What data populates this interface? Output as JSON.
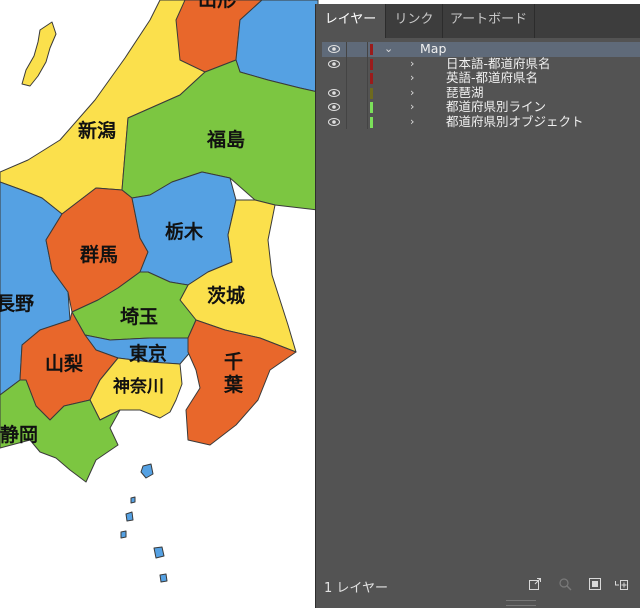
{
  "map": {
    "colors": {
      "yellow": "#fbe04c",
      "green": "#7cc641",
      "blue": "#55a1e3",
      "orange": "#e8672b",
      "sea": "#ffffff",
      "border": "#3a3a3a"
    },
    "prefectures": {
      "niigata": "新潟",
      "fukushima": "福島",
      "tochigi": "栃木",
      "gunma": "群馬",
      "ibaraki": "茨城",
      "nagano": "長野",
      "saitama": "埼玉",
      "yamanashi": "山梨",
      "tokyo": "東京",
      "chiba_1": "千",
      "chiba_2": "葉",
      "kanagawa": "神奈川",
      "shizuoka": "静岡",
      "yamagata_partial": "山形"
    }
  },
  "layers_panel": {
    "tabs": [
      {
        "label": "レイヤー",
        "active": true
      },
      {
        "label": "リンク",
        "active": false
      },
      {
        "label": "アートボード",
        "active": false
      }
    ],
    "layers": [
      {
        "name": "Map",
        "expanded": true,
        "visible": true,
        "color": "#9b1b1b"
      },
      {
        "name": "日本語-都道府県名",
        "expanded": false,
        "visible": true,
        "color": "#9b1b1b"
      },
      {
        "name": "英語-都道府県名",
        "expanded": false,
        "visible": false,
        "color": "#9b1b1b"
      },
      {
        "name": "琵琶湖",
        "expanded": false,
        "visible": true,
        "color": "#6e6a1e"
      },
      {
        "name": "都道府県別ライン",
        "expanded": false,
        "visible": true,
        "color": "#7be05a"
      },
      {
        "name": "都道府県別オブジェクト",
        "expanded": false,
        "visible": true,
        "color": "#7be05a"
      }
    ],
    "footer": {
      "layer_count": "1 レイヤー",
      "icons": [
        "export-icon",
        "locate-object-icon",
        "make-clipping-mask-icon",
        "new-sublayer-icon"
      ]
    }
  }
}
